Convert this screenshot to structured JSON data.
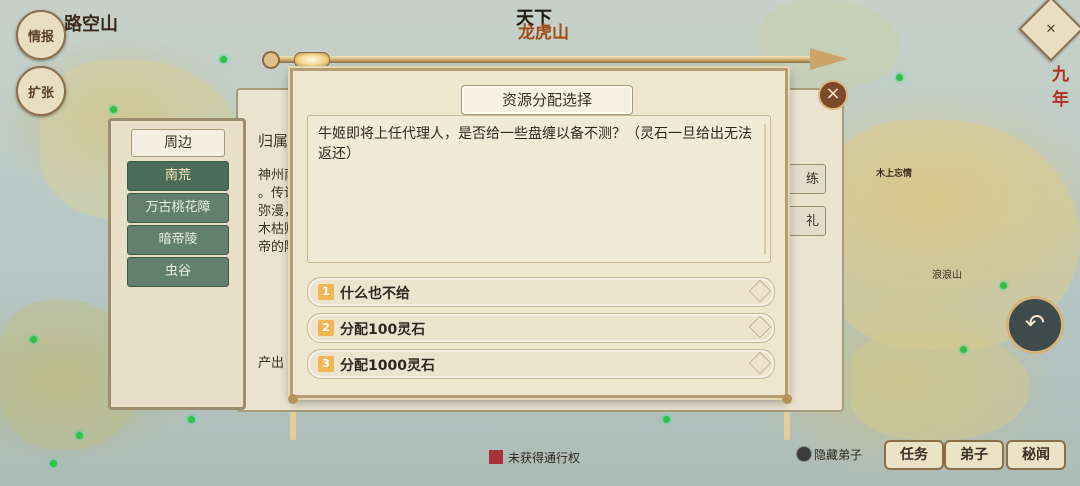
{
  "map": {
    "labels": {
      "luokongshan": "路空山",
      "tianxia": "天下",
      "longhushan": "龙虎山",
      "jiunian": "九年",
      "langlangshan": "浪浪山",
      "shangren": "木上忘情"
    },
    "side_buttons": {
      "intel": "情报",
      "expand": "扩张"
    }
  },
  "left_panel": {
    "title": "周边",
    "items": [
      "南荒",
      "万古桃花障",
      "暗帝陵",
      "虫谷"
    ]
  },
  "background": {
    "section_label": "归属",
    "desc_lines": [
      "神州南",
      "。传说",
      "弥漫，",
      "木枯败",
      "帝的陵"
    ],
    "output_label": "产出",
    "side_btns": [
      "练",
      "礼"
    ]
  },
  "dialog": {
    "title": "资源分配选择",
    "message": "牛姬即将上任代理人，是否给一些盘缠以备不测？（灵石一旦给出无法返还）",
    "options": [
      {
        "num": "1",
        "label": "什么也不给"
      },
      {
        "num": "2",
        "label": "分配100灵石"
      },
      {
        "num": "3",
        "label": "分配1000灵石"
      }
    ],
    "close_icon": "close-icon"
  },
  "bottom": {
    "legend_text": "未获得通行权",
    "legend_color": "#a8323a",
    "hide_disciples": "隐藏弟子",
    "buttons": [
      "任务",
      "弟子",
      "秘闻"
    ]
  }
}
